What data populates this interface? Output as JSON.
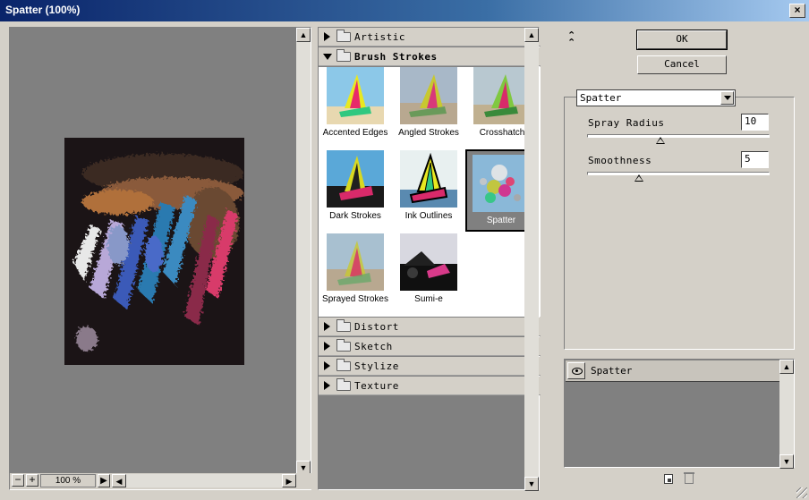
{
  "window": {
    "title": "Spatter (100%)",
    "close_glyph": "×"
  },
  "preview": {
    "zoom_level": "100 %",
    "zoom_out_label": "−",
    "zoom_in_label": "+",
    "zoom_menu_glyph": "▶"
  },
  "browser": {
    "categories_top": [
      {
        "label": "Artistic",
        "expanded": false
      }
    ],
    "active_category": {
      "label": "Brush Strokes",
      "expanded": true
    },
    "filters": [
      {
        "label": "Accented Edges",
        "selected": false
      },
      {
        "label": "Angled Strokes",
        "selected": false
      },
      {
        "label": "Crosshatch",
        "selected": false
      },
      {
        "label": "Dark Strokes",
        "selected": false
      },
      {
        "label": "Ink Outlines",
        "selected": false
      },
      {
        "label": "Spatter",
        "selected": true
      },
      {
        "label": "Sprayed Strokes",
        "selected": false
      },
      {
        "label": "Sumi-e",
        "selected": false
      }
    ],
    "categories_bottom": [
      {
        "label": "Distort"
      },
      {
        "label": "Sketch"
      },
      {
        "label": "Stylize"
      },
      {
        "label": "Texture"
      }
    ]
  },
  "buttons": {
    "ok": "OK",
    "cancel": "Cancel"
  },
  "settings": {
    "filter_select": "Spatter",
    "params": [
      {
        "label": "Spray Radius",
        "value": "10",
        "min": 0,
        "max": 25
      },
      {
        "label": "Smoothness",
        "value": "5",
        "min": 1,
        "max": 15
      }
    ]
  },
  "layers": {
    "items": [
      {
        "label": "Spatter",
        "visible": true
      }
    ]
  },
  "colors": {
    "titlebar": "#0a246a",
    "dialog": "#d4d0c8",
    "panel": "#808080"
  },
  "icons": [
    "close-icon",
    "collapse-icon",
    "chevron-down-icon",
    "eye-icon",
    "new-layer-icon",
    "trash-icon",
    "folder-icon"
  ]
}
